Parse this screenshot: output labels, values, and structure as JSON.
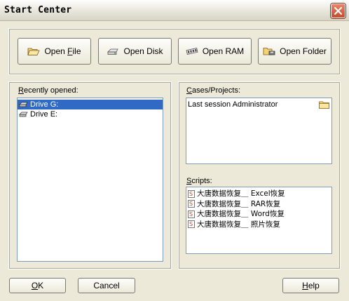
{
  "window": {
    "title": "Start Center"
  },
  "toolbar": {
    "open_file": {
      "prefix": "Open ",
      "accel": "F",
      "rest": "ile"
    },
    "open_disk": "Open Disk",
    "open_ram": "Open RAM",
    "open_folder": "Open Folder"
  },
  "recent": {
    "label_accel": "R",
    "label_rest": "ecently opened:",
    "items": [
      {
        "label": "Drive G:",
        "selected": true
      },
      {
        "label": "Drive E:",
        "selected": false
      }
    ]
  },
  "cases": {
    "label_accel": "C",
    "label_rest": "ases/Projects:",
    "items": [
      {
        "label": "Last session Administrator"
      }
    ]
  },
  "scripts": {
    "label_accel": "S",
    "label_rest": "cripts:",
    "items": [
      {
        "label": "大唐数据恢复＿ Excel恢复"
      },
      {
        "label": "大唐数据恢复＿ RAR恢复"
      },
      {
        "label": "大唐数据恢复＿ Word恢复"
      },
      {
        "label": "大唐数据恢复＿ 照片恢复"
      }
    ]
  },
  "footer": {
    "ok": {
      "accel": "O",
      "rest": "K"
    },
    "cancel": "Cancel",
    "help": {
      "accel": "H",
      "rest": "elp"
    }
  }
}
